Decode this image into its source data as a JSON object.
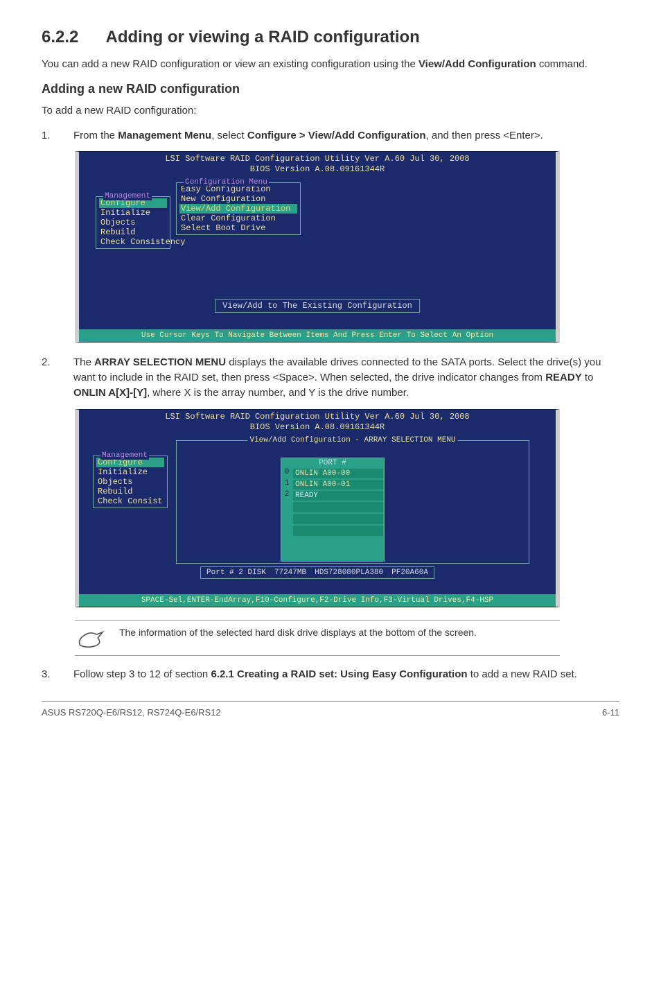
{
  "section": {
    "number": "6.2.2",
    "title": "Adding or viewing a RAID configuration"
  },
  "intro": {
    "text_a": "You can add a new RAID configuration or view an existing configuration using the ",
    "bold": "View/Add Configuration",
    "text_b": " command."
  },
  "subsection": {
    "title": "Adding a new RAID configuration",
    "lead": "To add a new RAID configuration:"
  },
  "step1": {
    "num": "1.",
    "a": "From the ",
    "b1": "Management Menu",
    "b": ", select ",
    "b2": "Configure > View/Add Configuration",
    "c": ", and then press <Enter>."
  },
  "bios1": {
    "title": "LSI Software RAID Configuration Utility Ver A.60 Jul 30, 2008",
    "subtitle": "BIOS Version   A.08.09161344R",
    "mgmt_legend": "Management",
    "cfg_legend": "Configuration Menu",
    "mgmt_items": [
      "Configure",
      "Initialize",
      "Objects",
      "Rebuild",
      "Check Consistency"
    ],
    "cfg_items": [
      "Easy Configuration",
      "New Configuration",
      "View/Add Configuration",
      "Clear Configuration",
      "Select Boot Drive"
    ],
    "status": "View/Add to The Existing Configuration",
    "footer": "Use Cursor Keys To Navigate Between Items And Press Enter To Select An Option"
  },
  "step2": {
    "num": "2.",
    "a": "The ",
    "b1": "ARRAY SELECTION MENU",
    "b": " displays the available drives connected to the SATA ports. Select the drive(s) you want to include in the RAID set, then press <Space>. When selected, the drive indicator changes from ",
    "b2": "READY",
    "c": " to ",
    "b3": "ONLIN A[X]-[Y]",
    "d": ", where X is the array number, and Y is the drive number."
  },
  "bios2": {
    "title": "LSI Software RAID Configuration Utility Ver A.60 Jul 30, 2008",
    "subtitle": "BIOS Version   A.08.09161344R",
    "mgmt_legend": "Management",
    "mgmt_items": [
      "Configure",
      "Initialize",
      "Objects",
      "Rebuild",
      "Check Consist"
    ],
    "sel_legend": "View/Add Configuration - ARRAY SELECTION MENU",
    "port_head": "PORT #",
    "ports": [
      {
        "idx": "0",
        "label": "ONLIN A00-00"
      },
      {
        "idx": "1",
        "label": "ONLIN A00-01"
      },
      {
        "idx": "2",
        "label": "READY"
      }
    ],
    "disk_info": {
      "port": "Port # 2 DISK",
      "size": "77247MB",
      "model": "HDS728080PLA380",
      "fw": "PF20A60A"
    },
    "footer": "SPACE-Sel,ENTER-EndArray,F10-Configure,F2-Drive Info,F3-Virtual Drives,F4-HSP"
  },
  "note": "The information of the selected hard disk drive displays at the bottom of the screen.",
  "step3": {
    "num": "3.",
    "a": "Follow step 3 to 12 of section ",
    "b1": "6.2.1 Creating a RAID set: Using Easy Configuration",
    "b": " to add a new RAID set."
  },
  "footer": {
    "left": "ASUS RS720Q-E6/RS12, RS724Q-E6/RS12",
    "right": "6-11"
  }
}
